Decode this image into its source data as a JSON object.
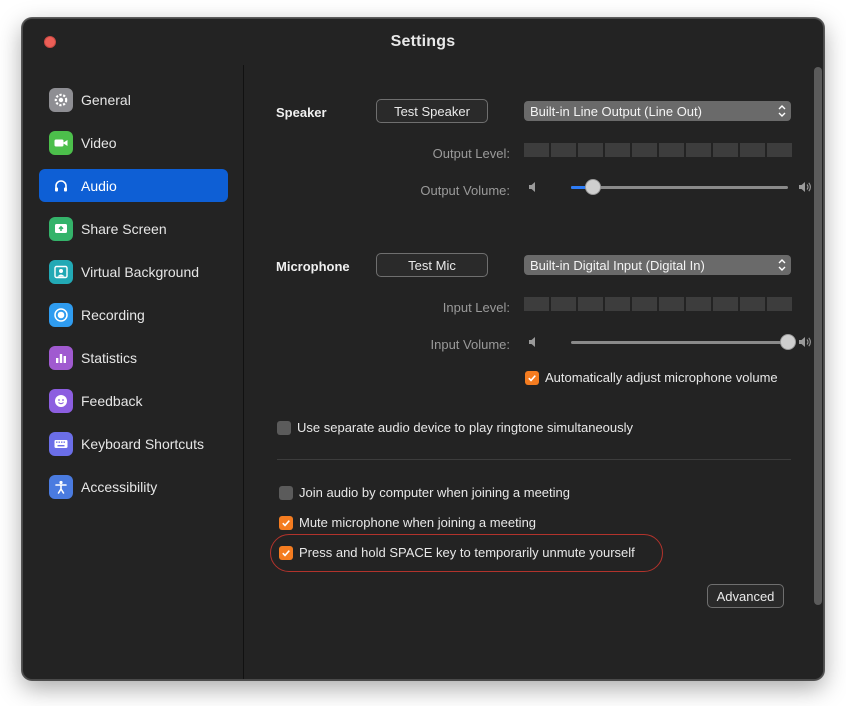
{
  "window": {
    "title": "Settings"
  },
  "sidebar": {
    "items": [
      {
        "label": "General",
        "icon": "gear-icon",
        "color": "#8e8e93",
        "active": false
      },
      {
        "label": "Video",
        "icon": "video-camera-icon",
        "color": "#4cbf4b",
        "active": false
      },
      {
        "label": "Audio",
        "icon": "headphones-icon",
        "color": "#0e5fd5",
        "active": true
      },
      {
        "label": "Share Screen",
        "icon": "share-screen-icon",
        "color": "#34b36a",
        "active": false
      },
      {
        "label": "Virtual Background",
        "icon": "virtual-background-icon",
        "color": "#22a9b5",
        "active": false
      },
      {
        "label": "Recording",
        "icon": "record-icon",
        "color": "#2f9cf0",
        "active": false
      },
      {
        "label": "Statistics",
        "icon": "bar-chart-icon",
        "color": "#a05ad0",
        "active": false
      },
      {
        "label": "Feedback",
        "icon": "smiley-icon",
        "color": "#8c5ee0",
        "active": false
      },
      {
        "label": "Keyboard Shortcuts",
        "icon": "keyboard-icon",
        "color": "#6b6ee8",
        "active": false
      },
      {
        "label": "Accessibility",
        "icon": "accessibility-icon",
        "color": "#4a7be0",
        "active": false
      }
    ]
  },
  "speaker": {
    "label": "Speaker",
    "test_button": "Test Speaker",
    "device": "Built-in Line Output (Line Out)",
    "output_level_label": "Output Level:",
    "output_volume_label": "Output Volume:",
    "volume_fraction": 0.1
  },
  "microphone": {
    "label": "Microphone",
    "test_button": "Test Mic",
    "device": "Built-in Digital Input (Digital In)",
    "input_level_label": "Input Level:",
    "input_volume_label": "Input Volume:",
    "volume_fraction": 1.0,
    "auto_adjust_label": "Automatically adjust microphone volume",
    "auto_adjust_checked": true
  },
  "options": {
    "separate_device_label": "Use separate audio device to play ringtone simultaneously",
    "separate_device_checked": false,
    "join_audio_label": "Join audio by computer when joining a meeting",
    "join_audio_checked": false,
    "mute_mic_label": "Mute microphone when joining a meeting",
    "mute_mic_checked": true,
    "space_unmute_label": "Press and hold SPACE key to temporarily unmute yourself",
    "space_unmute_checked": true
  },
  "advanced_button": "Advanced",
  "colors": {
    "accent": "#0e5fd5",
    "checkbox_on": "#f47c20",
    "highlight_ring": "#b2332c"
  }
}
